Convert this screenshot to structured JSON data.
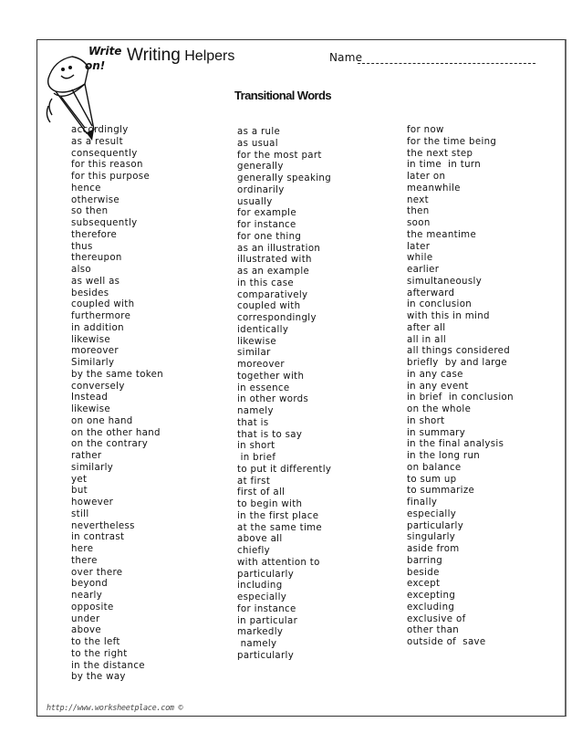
{
  "header": {
    "logo_text_line1": "Write",
    "logo_text_line2": "on!",
    "title_part1": "Writing",
    "title_part2": "Helpers",
    "name_label": "Name"
  },
  "subtitle": "Transitional Words",
  "columns": [
    {
      "words": [
        "accordingly",
        "as a result",
        "consequently",
        "for this reason",
        "for this purpose",
        "hence",
        "otherwise",
        "so then",
        "subsequently",
        "therefore",
        "thus",
        "thereupon",
        "also",
        "as well as",
        "besides",
        "coupled with",
        "furthermore",
        "in addition",
        "likewise",
        "moreover",
        "Similarly",
        "by the same token",
        "conversely",
        "Instead",
        "likewise",
        "on one hand",
        "on the other hand",
        "on the contrary",
        "rather",
        "similarly",
        "yet",
        "but",
        "however",
        "still",
        "nevertheless",
        "in contrast",
        "here",
        "there",
        "over there",
        "beyond",
        "nearly",
        "opposite",
        "under",
        "above",
        "to the left",
        "to the right",
        "in the distance",
        "by the way"
      ]
    },
    {
      "words": [
        "as a rule",
        "as usual",
        "for the most part",
        "generally",
        "generally speaking",
        "ordinarily",
        "usually",
        "for example",
        "for instance",
        "for one thing",
        "as an illustration",
        "illustrated with",
        "as an example",
        "in this case",
        "comparatively",
        "coupled with",
        "correspondingly",
        "identically",
        "likewise",
        "similar",
        "moreover",
        "together with",
        "in essence",
        "in other words",
        "namely",
        "that is",
        "that is to say",
        "in short",
        " in brief",
        "to put it differently",
        "at first",
        "first of all",
        "to begin with",
        "in the first place",
        "at the same time",
        "above all",
        "chiefly",
        "with attention to",
        "particularly",
        "including",
        "especially",
        "for instance",
        "in particular",
        "markedly",
        " namely",
        "particularly"
      ]
    },
    {
      "words": [
        "for now",
        "for the time being",
        "the next step",
        "in time  in turn",
        "later on",
        "meanwhile",
        "next",
        "then",
        "soon",
        "the meantime",
        "later",
        "while",
        "earlier",
        "simultaneously",
        "afterward",
        "in conclusion",
        "with this in mind",
        "after all",
        "all in all",
        "all things considered",
        "briefly  by and large",
        "in any case",
        "in any event",
        "in brief  in conclusion",
        "on the whole",
        "in short",
        "in summary",
        "in the final analysis",
        "in the long run",
        "on balance",
        "to sum up",
        "to summarize",
        "finally",
        "especially",
        "particularly",
        "singularly",
        "aside from",
        "barring",
        "beside",
        "except",
        "excepting",
        "excluding",
        "exclusive of",
        "other than",
        "outside of  save"
      ]
    }
  ],
  "footer": "http://www.worksheetplace.com ©"
}
